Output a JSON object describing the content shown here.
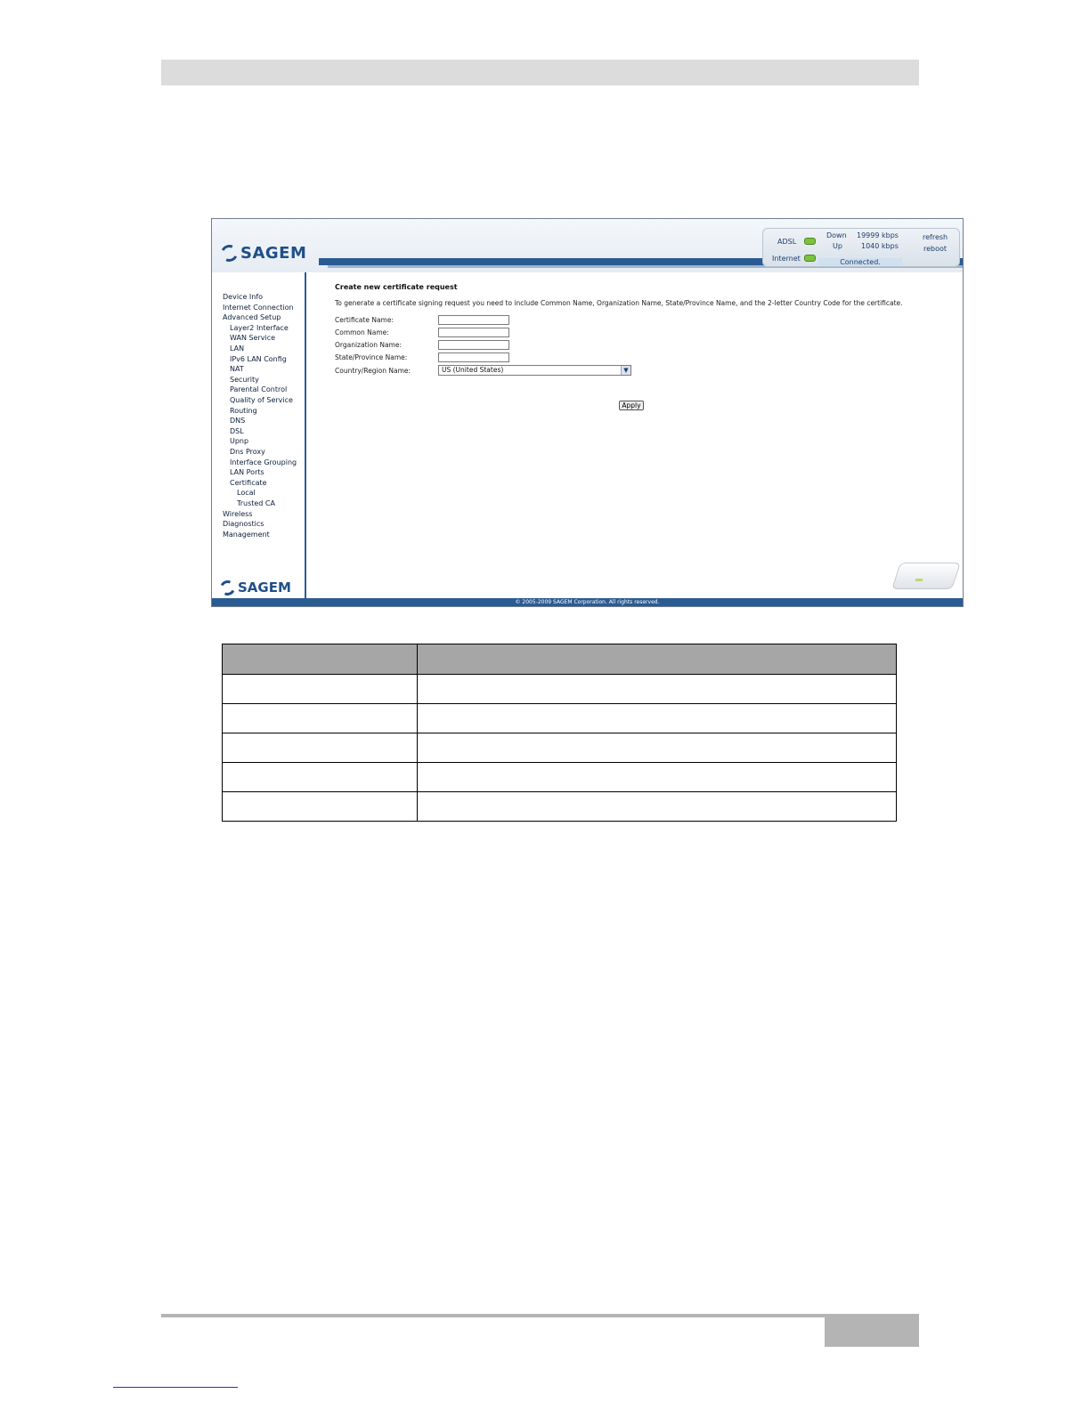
{
  "sidebar": {
    "items": [
      {
        "label": "Device Info",
        "level": 0
      },
      {
        "label": "Internet Connection",
        "level": 0
      },
      {
        "label": "Advanced Setup",
        "level": 0
      },
      {
        "label": "Layer2 Interface",
        "level": 1
      },
      {
        "label": "WAN Service",
        "level": 1
      },
      {
        "label": "LAN",
        "level": 1
      },
      {
        "label": "IPv6 LAN Config",
        "level": 1
      },
      {
        "label": "NAT",
        "level": 1
      },
      {
        "label": "Security",
        "level": 1
      },
      {
        "label": "Parental Control",
        "level": 1
      },
      {
        "label": "Quality of Service",
        "level": 1
      },
      {
        "label": "Routing",
        "level": 1
      },
      {
        "label": "DNS",
        "level": 1
      },
      {
        "label": "DSL",
        "level": 1
      },
      {
        "label": "Upnp",
        "level": 1
      },
      {
        "label": "Dns Proxy",
        "level": 1
      },
      {
        "label": "Interface Grouping",
        "level": 1
      },
      {
        "label": "LAN Ports",
        "level": 1
      },
      {
        "label": "Certificate",
        "level": 1
      },
      {
        "label": "Local",
        "level": 2
      },
      {
        "label": "Trusted CA",
        "level": 2
      },
      {
        "label": "Wireless",
        "level": 0
      },
      {
        "label": "Diagnostics",
        "level": 0
      },
      {
        "label": "Management",
        "level": 0
      }
    ]
  },
  "header": {
    "logo_text": "SAGEM",
    "status": {
      "adsl_label": "ADSL",
      "internet_label": "Internet",
      "down_label": "Down",
      "down_value": "19999 kbps",
      "up_label": "Up",
      "up_value": "1040 kbps",
      "connection_status": "Connected."
    },
    "refresh_label": "refresh",
    "reboot_label": "reboot"
  },
  "main": {
    "title": "Create new certificate request",
    "description": "To generate a certificate signing request you need to include Common Name, Organization Name, State/Province Name, and the 2-letter Country Code for the certificate.",
    "fields": [
      {
        "label": "Certificate Name:",
        "value": ""
      },
      {
        "label": "Common Name:",
        "value": ""
      },
      {
        "label": "Organization Name:",
        "value": ""
      },
      {
        "label": "State/Province Name:",
        "value": ""
      }
    ],
    "country_label": "Country/Region Name:",
    "country_selected": "US (United States)",
    "apply_label": "Apply"
  },
  "footer": {
    "copyright": "© 2005-2009 SAGEM Corporation. All rights reserved."
  },
  "icons": {
    "logo": "sagem-logo-icon",
    "led": "status-led-icon",
    "device": "router-device-icon"
  },
  "colors": {
    "brand_blue": "#2b5b93",
    "led_green": "#7cc142",
    "header_band": "#dcdcdc",
    "table_header": "#a6a6a6"
  }
}
